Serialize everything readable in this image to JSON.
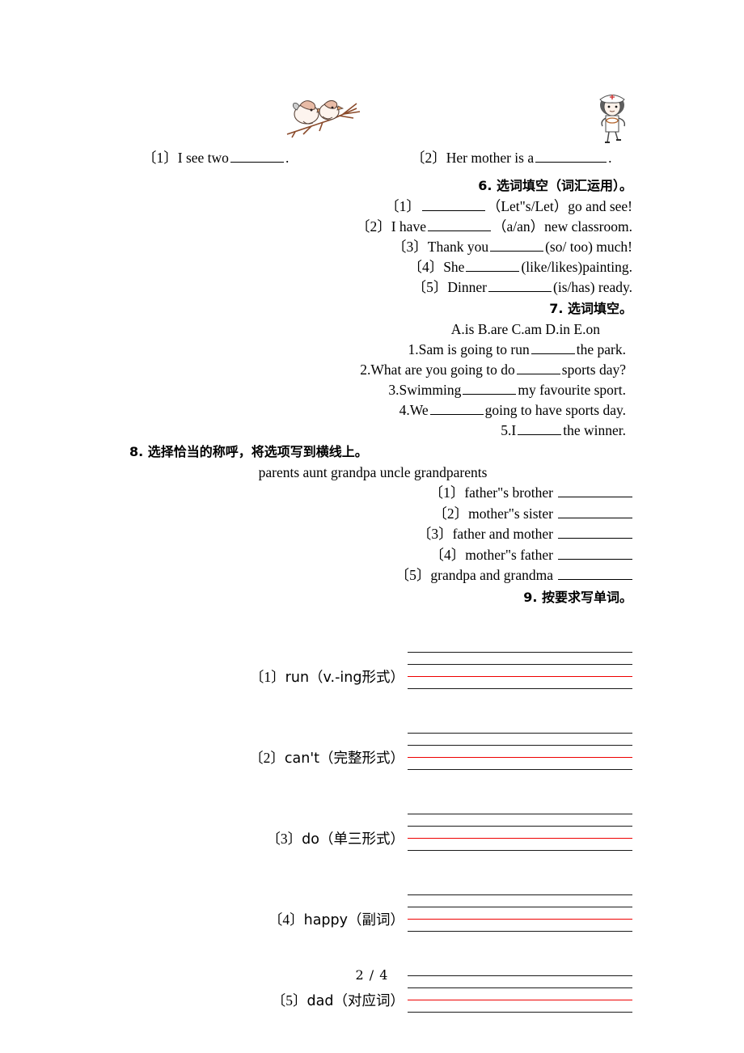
{
  "page": {
    "footer": "2 / 4"
  },
  "images": {
    "birds": "two-birds-on-branch-image",
    "nurse": "nurse-girl-image"
  },
  "top_questions": [
    {
      "num": "〔1〕",
      "text_before": "I see two",
      "text_after": "."
    },
    {
      "num": "〔2〕",
      "text_before": "Her mother is a",
      "text_after": "."
    }
  ],
  "section6": {
    "heading": "6. 选词填空（词汇运用）。",
    "items": [
      {
        "num": "〔1〕",
        "before": "",
        "after": "（Let\"s/Let）go and see!"
      },
      {
        "num": "〔2〕",
        "before": "I have",
        "after": "（a/an）new classroom."
      },
      {
        "num": "〔3〕",
        "before": "Thank you",
        "after": "(so/ too) much!"
      },
      {
        "num": "〔4〕",
        "before": "She",
        "after": "(like/likes)painting."
      },
      {
        "num": "〔5〕",
        "before": "Dinner",
        "after": "(is/has) ready."
      }
    ]
  },
  "section7": {
    "heading": "7. 选词填空。",
    "options": "A.is   B.are C.am D.in E.on",
    "items": [
      {
        "num": "1.",
        "before": "Sam is going to run",
        "after": "the park."
      },
      {
        "num": "2.",
        "before": "What are you going to do",
        "after": "sports day?"
      },
      {
        "num": "3.",
        "before": "Swimming",
        "after": "my favourite sport."
      },
      {
        "num": "4.",
        "before": "We",
        "after": "going to have sports day."
      },
      {
        "num": "5.",
        "before": "I",
        "after": "the winner."
      }
    ]
  },
  "section8": {
    "heading": "8. 选择恰当的称呼，将选项写到横线上。",
    "word_bank": "parents aunt grandpa uncle grandparents",
    "items": [
      {
        "num": "〔1〕",
        "text": "father\"s brother"
      },
      {
        "num": "〔2〕",
        "text": "mother\"s sister"
      },
      {
        "num": "〔3〕",
        "text": "father and mother"
      },
      {
        "num": "〔4〕",
        "text": "mother\"s father"
      },
      {
        "num": "〔5〕",
        "text": "grandpa and grandma"
      }
    ]
  },
  "section9": {
    "heading": "9. 按要求写单词。",
    "items": [
      {
        "num": "〔1〕",
        "text": "run（v.-ing形式）"
      },
      {
        "num": "〔2〕",
        "text": "can't（完整形式）"
      },
      {
        "num": "〔3〕",
        "text": "do（单三形式）"
      },
      {
        "num": "〔4〕",
        "text": "happy（副词）"
      },
      {
        "num": "〔5〕",
        "text": "dad（对应词）"
      }
    ]
  },
  "colors": {
    "text": "#000000",
    "guide_line": "#1a1a1a",
    "guide_red_line": "#ee0000",
    "background": "#ffffff"
  }
}
